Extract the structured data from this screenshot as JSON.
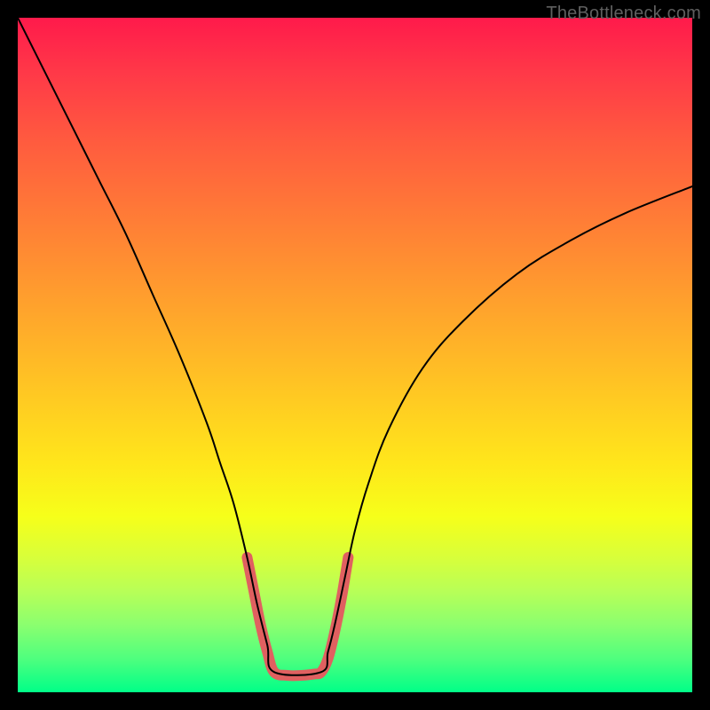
{
  "watermark": "TheBottleneck.com",
  "chart_data": {
    "type": "line",
    "title": "",
    "xlabel": "",
    "ylabel": "",
    "xlim": [
      0,
      100
    ],
    "ylim": [
      0,
      100
    ],
    "grid": false,
    "legend": false,
    "series": [
      {
        "name": "main-curve",
        "color": "#000000",
        "stroke_width": 2,
        "x": [
          0,
          4,
          8,
          12,
          16,
          20,
          24,
          28,
          30,
          32,
          34,
          35.5,
          37,
          38,
          45,
          46,
          47,
          48.5,
          50,
          52,
          55,
          60,
          66,
          74,
          82,
          90,
          100
        ],
        "y": [
          100,
          92,
          84,
          76,
          68,
          59,
          50,
          40,
          34,
          28,
          20,
          13,
          7,
          3,
          3,
          6,
          10,
          17,
          24,
          31,
          39,
          48,
          55,
          62,
          67,
          71,
          75
        ]
      },
      {
        "name": "highlight-segment",
        "color": "#e06060",
        "stroke_width": 12,
        "x": [
          34,
          35,
          36,
          37,
          38,
          40,
          42,
          44,
          45,
          46,
          47,
          48,
          49
        ],
        "y": [
          20,
          15,
          10,
          6,
          3,
          2.5,
          2.5,
          2.7,
          3,
          5,
          9,
          14,
          20
        ]
      }
    ],
    "background_gradient": {
      "direction": "top-to-bottom",
      "stops": [
        {
          "pos": 0.0,
          "color": "#ff1a4b"
        },
        {
          "pos": 0.3,
          "color": "#ff7d36"
        },
        {
          "pos": 0.66,
          "color": "#ffe61b"
        },
        {
          "pos": 0.85,
          "color": "#b8ff57"
        },
        {
          "pos": 1.0,
          "color": "#00ff88"
        }
      ]
    }
  }
}
